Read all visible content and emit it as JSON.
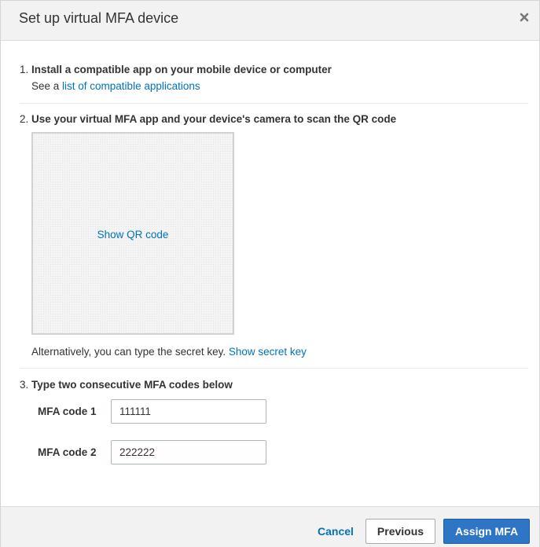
{
  "dialog": {
    "title": "Set up virtual MFA device",
    "close_icon": "close-icon"
  },
  "steps": [
    {
      "number": "1.",
      "text": "Install a compatible app on your mobile device or computer",
      "sub_prefix": "See a ",
      "sub_link": "list of compatible applications"
    },
    {
      "number": "2.",
      "text": "Use your virtual MFA app and your device's camera to scan the QR code",
      "qr_link": "Show QR code",
      "alt_prefix": "Alternatively, you can type the secret key.",
      "alt_link": "Show secret key"
    },
    {
      "number": "3.",
      "text": "Type two consecutive MFA codes below"
    }
  ],
  "fields": [
    {
      "label": "MFA code 1",
      "value": "111111"
    },
    {
      "label": "MFA code 2",
      "value": "222222"
    }
  ],
  "footer": {
    "cancel": "Cancel",
    "previous": "Previous",
    "assign": "Assign MFA"
  },
  "colors": {
    "link": "#0073bb",
    "primary_button": "#2f75c5",
    "header_bg": "#f2f2f2"
  }
}
